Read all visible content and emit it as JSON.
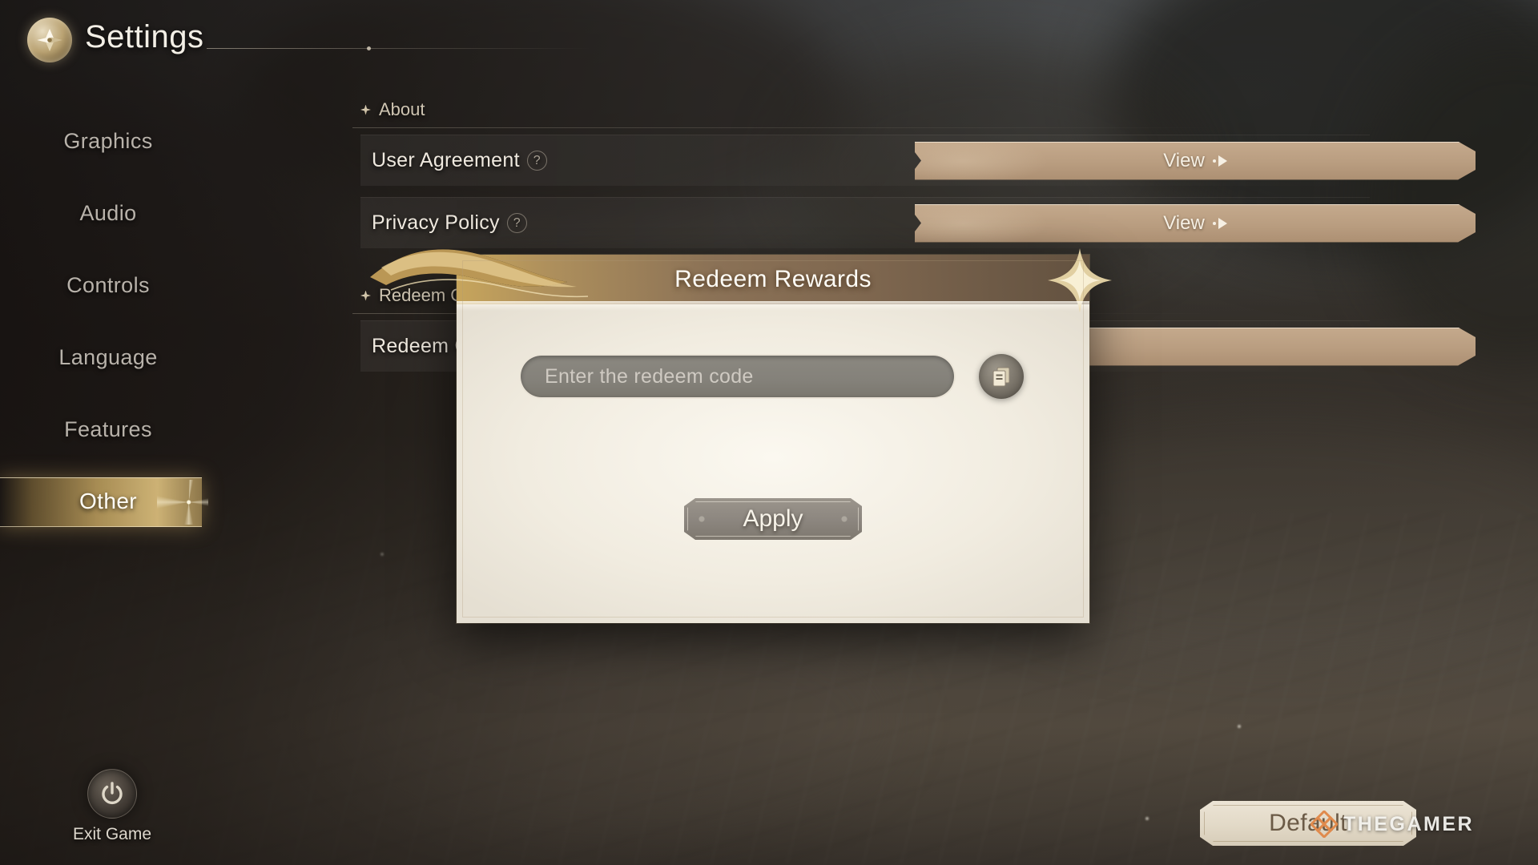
{
  "header": {
    "title": "Settings",
    "emblem_icon": "compass-emblem-icon"
  },
  "sidebar": {
    "items": [
      {
        "label": "Graphics",
        "active": false
      },
      {
        "label": "Audio",
        "active": false
      },
      {
        "label": "Controls",
        "active": false
      },
      {
        "label": "Language",
        "active": false
      },
      {
        "label": "Features",
        "active": false
      },
      {
        "label": "Other",
        "active": true
      }
    ]
  },
  "exit": {
    "label": "Exit Game",
    "icon": "power-icon"
  },
  "content": {
    "sections": [
      {
        "title": "About",
        "icon": "sparkle-diamond-icon",
        "rows": [
          {
            "label": "User Agreement",
            "help_icon": "question-mark-icon",
            "button_label": "View",
            "button_icon": "arrow-right-icon"
          },
          {
            "label": "Privacy Policy",
            "help_icon": "question-mark-icon",
            "button_label": "View",
            "button_icon": "arrow-right-icon"
          }
        ]
      },
      {
        "title": "Redeem Code",
        "icon": "sparkle-diamond-icon",
        "rows": [
          {
            "label": "Redeem Code",
            "help_icon": "",
            "button_label": "",
            "button_icon": "arrow-right-icon"
          }
        ]
      }
    ]
  },
  "modal": {
    "title": "Redeem Rewards",
    "input": {
      "placeholder": "Enter the redeem code",
      "value": ""
    },
    "paste_button_icon": "paste-clipboard-icon",
    "apply_label": "Apply",
    "decor_left_icon": "gold-ribbon-icon",
    "decor_right_icon": "four-point-star-icon"
  },
  "footer": {
    "default_label": "Default"
  },
  "watermark": {
    "text": "THEGAMER",
    "mark_icon": "thegamer-knot-icon"
  },
  "colors": {
    "accent_gold": "#bc9e60",
    "button_tan": "#b99d80",
    "modal_paper": "#f1ece0",
    "text_light": "#efe9df",
    "watermark_orange": "#e08a4c"
  }
}
